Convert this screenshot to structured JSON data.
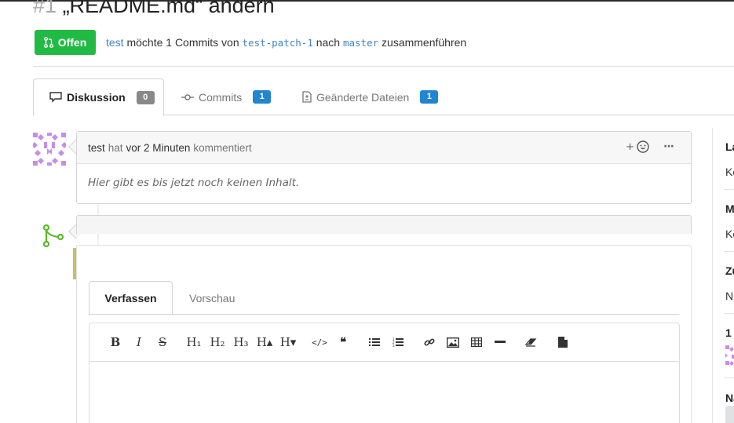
{
  "issue": {
    "number": "#1",
    "title": "„README.md“ ändern",
    "status": "Offen",
    "author": "test",
    "action_text": "möchte 1 Commits von",
    "source_branch": "test-patch-1",
    "into_text": "nach",
    "target_branch": "master",
    "merge_text": "zusammenführen"
  },
  "tabs": [
    {
      "label": "Diskussion",
      "count": "0"
    },
    {
      "label": "Commits",
      "count": "1"
    },
    {
      "label": "Geänderte Dateien",
      "count": "1"
    }
  ],
  "comment": {
    "author": "test",
    "verb": "hat",
    "time": "vor 2 Minuten",
    "action": "kommentiert",
    "add_reaction": "+",
    "more": "···",
    "body": "Hier gibt es bis jetzt noch keinen Inhalt."
  },
  "editor": {
    "tab_write": "Verfassen",
    "tab_preview": "Vorschau",
    "toolbar": {
      "bold": "B",
      "italic": "I",
      "strike": "S",
      "h1": "H₁",
      "h2": "H₂",
      "h3": "H₃",
      "h_bigger": "H▴",
      "h_smaller": "H▾",
      "code": "</>",
      "quote": "❝"
    }
  },
  "sidebar": {
    "labels_title": "La",
    "labels_value": "Ke",
    "milestone_title": "M",
    "milestone_value": "Ke",
    "assignees_title": "Zu",
    "assignees_value": "Ni",
    "participants_count": "1",
    "notifications_title": "Na"
  },
  "colors": {
    "open_green": "#21ba45",
    "link_blue": "#4183c4",
    "count_blue": "#2185d0",
    "count_grey": "#888888",
    "merge_green": "#5cb829",
    "avatar_purple": "#c58ee8"
  }
}
